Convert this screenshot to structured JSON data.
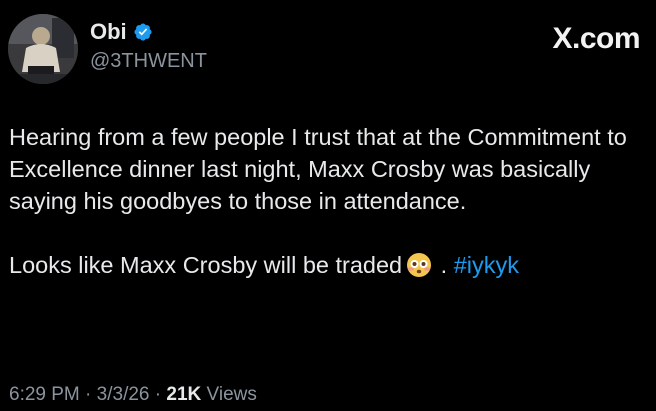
{
  "author": {
    "display_name": "Obi",
    "handle": "@3THWENT",
    "avatar_icon": "profile-photo",
    "verified_icon": "verified-badge-icon",
    "verified_color": "#1d9bf0"
  },
  "brand": {
    "logo_text": "X.com"
  },
  "tweet": {
    "paragraph1": "Hearing from a few people I trust that at the Commitment to Excellence dinner last night, Maxx Crosby was basically saying his goodbyes to those in attendance.",
    "paragraph2_text": "Looks like Maxx Crosby will be traded",
    "emoji_icon": "flushed-face-emoji-icon",
    "separator": ".",
    "hashtag": "#iykyk",
    "hashtag_color": "#1d9bf0"
  },
  "meta": {
    "time": "6:29 PM",
    "dot1": "·",
    "date": "3/3/26",
    "dot2": "·",
    "views_count": "21K",
    "views_label": "Views"
  }
}
